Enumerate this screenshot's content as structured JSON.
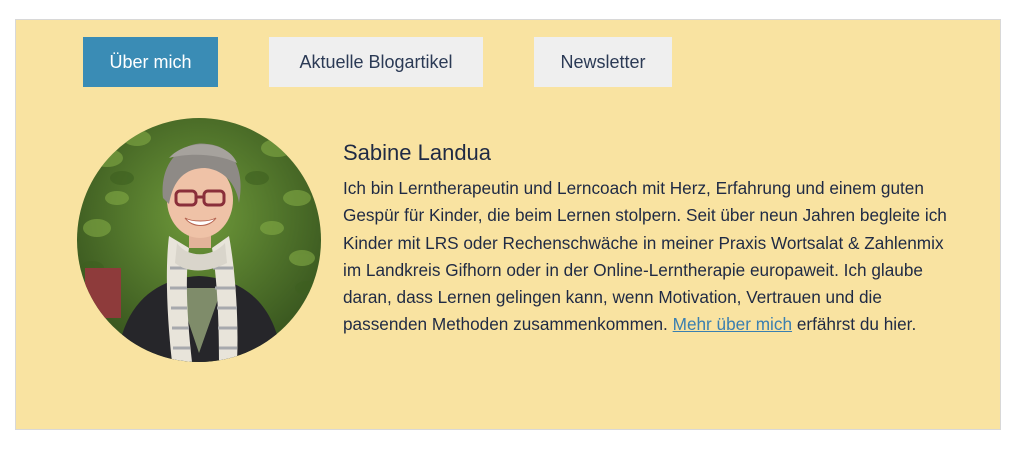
{
  "tabs": {
    "about": "Über mich",
    "blog": "Aktuelle Blogartikel",
    "newsletter": "Newsletter"
  },
  "author": {
    "name": "Sabine Landua",
    "bio_text": "Ich bin Lerntherapeutin und Lerncoach mit Herz, Erfahrung und einem guten Gespür für Kinder, die beim Lernen stolpern. Seit über neun Jahren begleite ich Kinder mit LRS oder Rechenschwäche in meiner Praxis Wortsalat & Zahlenmix im Landkreis Gifhorn oder in der Online-Lerntherapie europaweit. Ich glaube daran, dass Lernen gelingen kann, wenn Motivation, Vertrauen und die passenden Methoden zusammenkommen.",
    "link_text": "Mehr über mich",
    "bio_suffix": "erfährst du hier."
  },
  "colors": {
    "box_background": "#f9e3a1",
    "active_tab": "#3a8cb5",
    "inactive_tab": "#efefef",
    "text": "#1f2a44",
    "link": "#3a7fb0"
  }
}
